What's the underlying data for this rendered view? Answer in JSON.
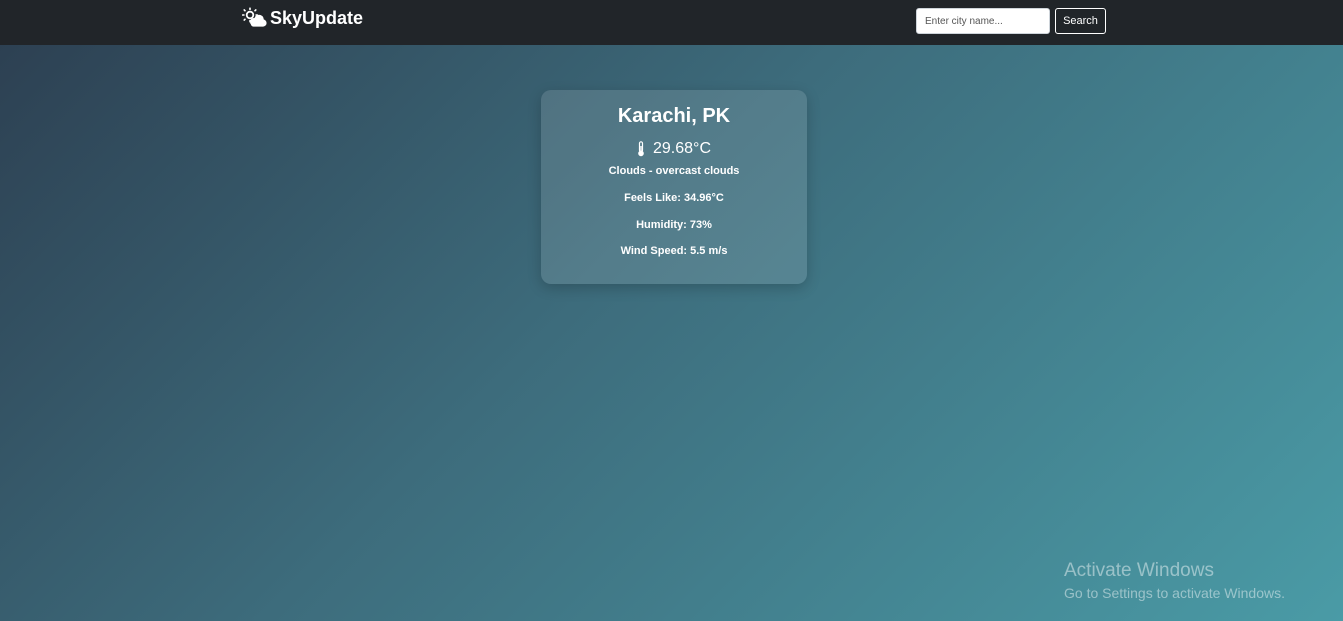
{
  "navbar": {
    "brand_icon": "sun-behind-cloud-icon",
    "brand_name": "SkyUpdate",
    "search": {
      "placeholder": "Enter city name...",
      "value": "",
      "button_label": "Search"
    }
  },
  "weather": {
    "city": "Karachi, PK",
    "temp_icon": "thermometer-icon",
    "temperature": "29.68°C",
    "description": "Clouds - overcast clouds",
    "feels_like": "Feels Like: 34.96°C",
    "humidity": "Humidity: 73%",
    "wind_speed": "Wind Speed: 5.5 m/s"
  },
  "os_watermark": {
    "title": "Activate Windows",
    "subtitle": "Go to Settings to activate Windows."
  },
  "colors": {
    "navbar_bg": "#212529",
    "gradient_start": "#2c3e50",
    "gradient_end": "#4a9ba6",
    "text": "#ffffff"
  }
}
